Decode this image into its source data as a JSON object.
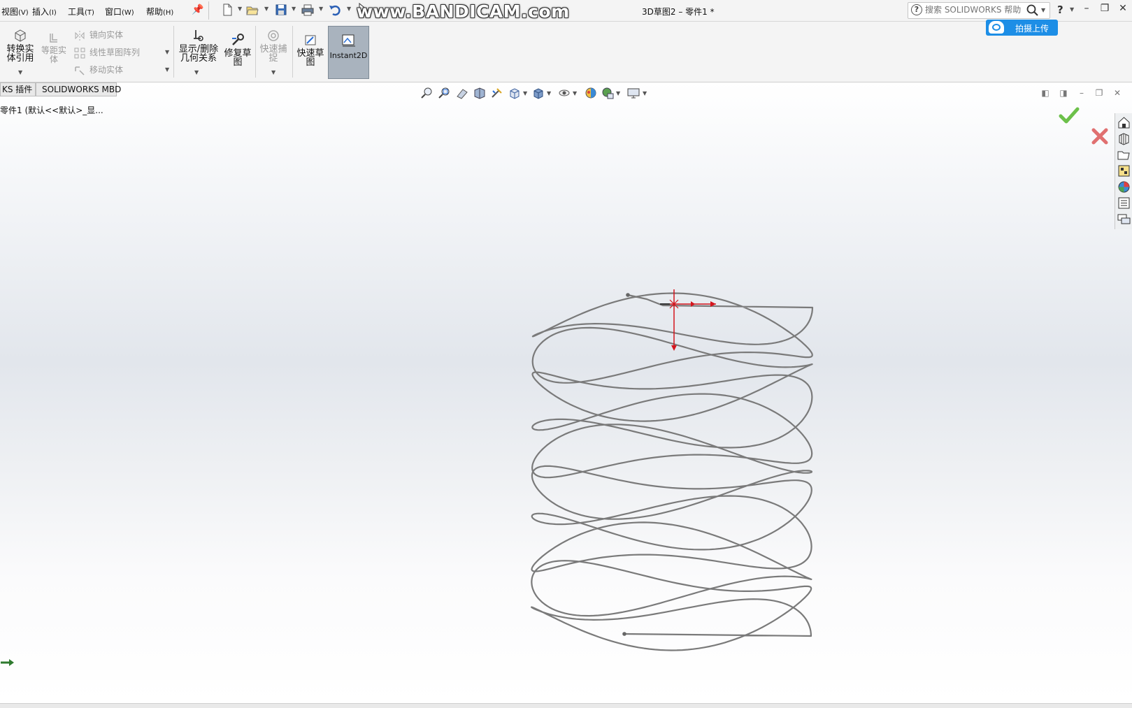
{
  "menu": {
    "view": "视图",
    "view_key": "(V)",
    "insert": "插入",
    "insert_key": "(I)",
    "tools": "工具",
    "tools_key": "(T)",
    "window": "窗口",
    "window_key": "(W)",
    "help": "帮助",
    "help_key": "(H)"
  },
  "watermark": "www.BANDICAM.com",
  "title": "3D草图2 – 零件1 *",
  "search": {
    "placeholder": "搜索 SOLIDWORKS 帮助"
  },
  "upload": {
    "label": "拍摄上传"
  },
  "ribbon": {
    "convert_entities": [
      "转换实",
      "体引用"
    ],
    "offset_entities": [
      "等距实",
      "体"
    ],
    "mirror_entities": "镜向实体",
    "linear_pattern": "线性草图阵列",
    "move_entities": "移动实体",
    "display_relations": [
      "显示/删除",
      "几何关系"
    ],
    "repair_sketch": [
      "修复草",
      "图"
    ],
    "quick_snaps": [
      "快速捕",
      "捉"
    ],
    "rapid_sketch": [
      "快速草",
      "图"
    ],
    "instant2d": "Instant2D"
  },
  "tabs": {
    "addins": "KS 插件",
    "mbd": "SOLIDWORKS MBD"
  },
  "tree": {
    "root": "零件1  (默认<<默认>_显..."
  },
  "colors": {
    "curve": "#7a7a7a",
    "triad_red": "#d4141c",
    "accent_blue": "#1d8ee6",
    "ok_green": "#6cc04a",
    "cancel_red": "#e05050"
  }
}
